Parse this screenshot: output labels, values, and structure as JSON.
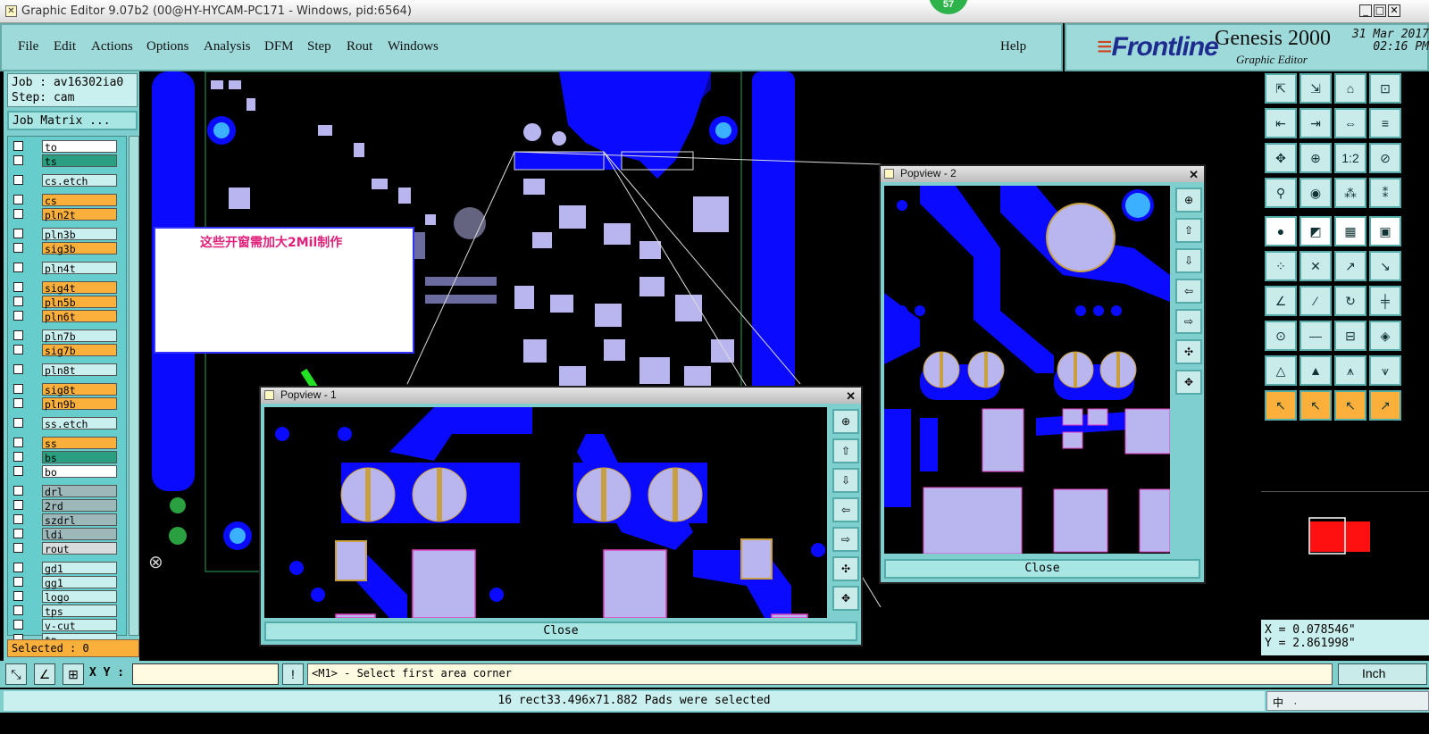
{
  "window": {
    "title": "Graphic Editor 9.07b2 (00@HY-HYCAM-PC171 - Windows, pid:6564)",
    "badge": "57",
    "min": "_",
    "max": "□",
    "close": "✕"
  },
  "menu": {
    "items": [
      "File",
      "Edit",
      "Actions",
      "Options",
      "Analysis",
      "DFM",
      "Step",
      "Rout",
      "Windows"
    ],
    "help": "Help"
  },
  "brand": {
    "logo": "Frontline",
    "product": "Genesis 2000",
    "subtitle": "Graphic Editor",
    "date": "31 Mar 2017",
    "time": "02:16 PM"
  },
  "job": {
    "job_line": "Job : av16302ia0",
    "step_line": "Step: cam",
    "matrix_button": "Job Matrix ..."
  },
  "layers": [
    {
      "name": "to",
      "bg": "#ffffff"
    },
    {
      "name": "ts",
      "bg": "#2aa080"
    },
    {
      "name": "cs.etch",
      "bg": "#c9f0ee"
    },
    {
      "name": "cs",
      "bg": "#fbb03b"
    },
    {
      "name": "pln2t",
      "bg": "#fbb03b"
    },
    {
      "name": "pln3b",
      "bg": "#c9f0ee"
    },
    {
      "name": "sig3b",
      "bg": "#fbb03b"
    },
    {
      "name": "pln4t",
      "bg": "#c9f0ee"
    },
    {
      "name": "sig4t",
      "bg": "#fbb03b"
    },
    {
      "name": "pln5b",
      "bg": "#fbb03b"
    },
    {
      "name": "pln6t",
      "bg": "#fbb03b"
    },
    {
      "name": "pln7b",
      "bg": "#c9f0ee"
    },
    {
      "name": "sig7b",
      "bg": "#fbb03b"
    },
    {
      "name": "pln8t",
      "bg": "#c9f0ee"
    },
    {
      "name": "sig8t",
      "bg": "#fbb03b"
    },
    {
      "name": "pln9b",
      "bg": "#fbb03b"
    },
    {
      "name": "ss.etch",
      "bg": "#c9f0ee"
    },
    {
      "name": "ss",
      "bg": "#fbb03b"
    },
    {
      "name": "bs",
      "bg": "#2aa080"
    },
    {
      "name": "bo",
      "bg": "#ffffff"
    },
    {
      "name": "drl",
      "bg": "#9cb8b8"
    },
    {
      "name": "2rd",
      "bg": "#9cb8b8"
    },
    {
      "name": "szdrl",
      "bg": "#9cb8b8"
    },
    {
      "name": "ldi",
      "bg": "#9cb8b8"
    },
    {
      "name": "rout",
      "bg": "#d8dcdc"
    },
    {
      "name": "gd1",
      "bg": "#c9f0ee"
    },
    {
      "name": "gg1",
      "bg": "#c9f0ee"
    },
    {
      "name": "logo",
      "bg": "#c9f0ee"
    },
    {
      "name": "tps",
      "bg": "#c9f0ee"
    },
    {
      "name": "v-cut",
      "bg": "#c9f0ee"
    },
    {
      "name": "tp",
      "bg": "#c9f0ee"
    }
  ],
  "selected": "Selected : 0",
  "note": "这些开窗需加大2Mil制作",
  "popview1": {
    "title": "Popview - 1",
    "close": "Close"
  },
  "popview2": {
    "title": "Popview - 2",
    "close": "Close"
  },
  "coords": {
    "x": "X = 0.078546\"",
    "y": "Y = 2.861998\""
  },
  "command": {
    "xy_label": "X Y :",
    "prompt": "<M1> - Select first area corner",
    "unit": "Inch"
  },
  "status": "16 rect33.496x71.882 Pads were selected",
  "tray": "中 ·"
}
